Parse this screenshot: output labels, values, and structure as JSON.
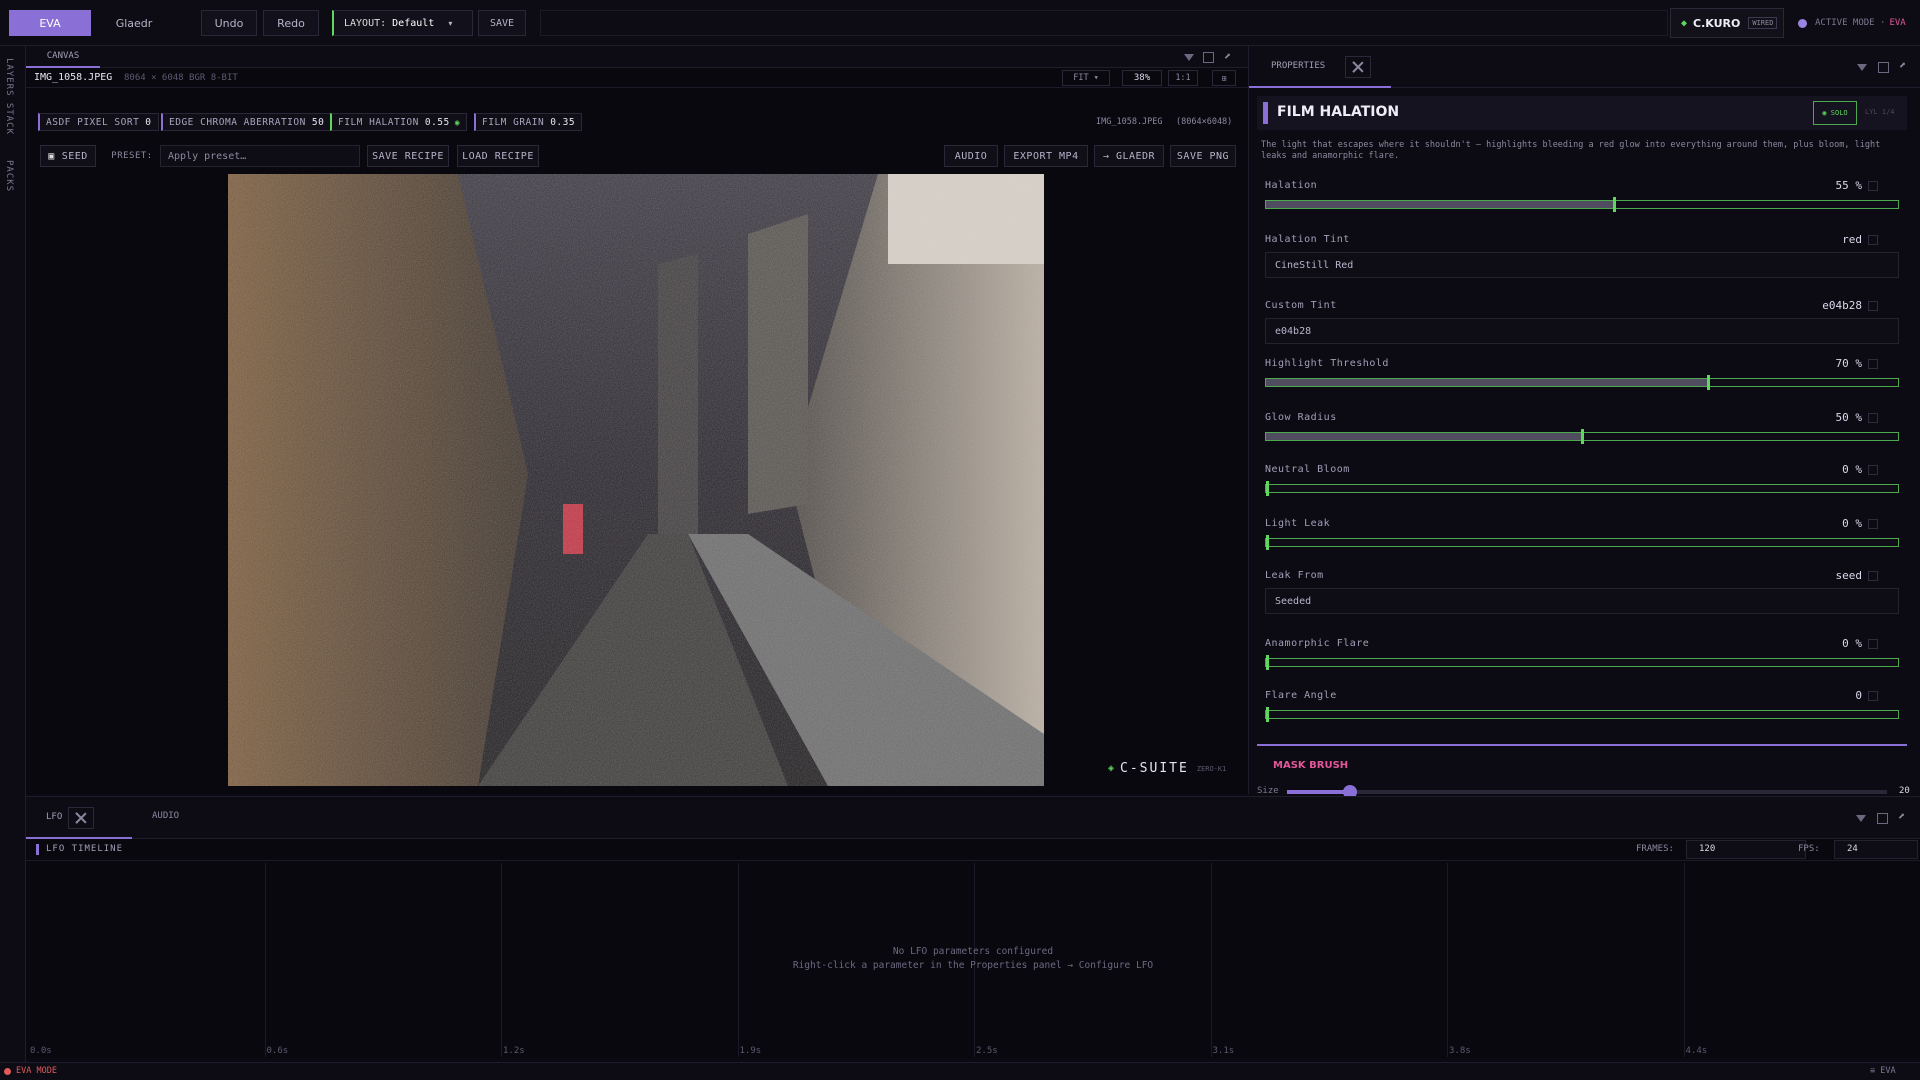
{
  "topbar": {
    "tab_eva": "EVA",
    "tab_glaedr": "Glaedr",
    "undo": "Undo",
    "redo": "Redo",
    "layout_label": "LAYOUT:",
    "layout_value": "Default",
    "save": "SAVE",
    "user": "C.KURO",
    "wired": "WIRED",
    "active_mode_label": "ACTIVE MODE ·",
    "active_mode_value": "EVA"
  },
  "leftrail": {
    "tab1": "LAYERS STACK",
    "tab2": "PACKS"
  },
  "canvas": {
    "tab": "CANVAS",
    "filename": "IMG_1058.JPEG",
    "fileinfo": "8064 × 6048 BGR 8-BIT",
    "fit": "FIT ▾",
    "zoom": "38%",
    "one_to_one": "1:1",
    "chips": [
      {
        "label": "ASDF PIXEL SORT",
        "value": "0"
      },
      {
        "label": "EDGE CHROMA ABERRATION",
        "value": "50"
      },
      {
        "label": "FILM HALATION",
        "value": "0.55"
      },
      {
        "label": "FILM GRAIN",
        "value": "0.35"
      }
    ],
    "info_right": "IMG_1058.JPEG",
    "info_dims": "(8064×6048)",
    "seed": "SEED",
    "preset_label": "PRESET:",
    "preset_placeholder": "Apply preset…",
    "save_recipe": "SAVE RECIPE",
    "load_recipe": "LOAD RECIPE",
    "audio": "AUDIO",
    "export_mp4": "EXPORT MP4",
    "to_glaedr": "→ GLAEDR",
    "save_png": "SAVE PNG",
    "brand": "C-SUITE",
    "brand_sub": "ZERO-K1"
  },
  "properties": {
    "tab": "PROPERTIES",
    "title": "FILM HALATION",
    "badge_solo": "◉ SOLO",
    "badge_extra": "LYL 1/4",
    "description": "The light that escapes where it shouldn't — highlights bleeding a red glow into everything around them, plus bloom, light leaks and anamorphic flare.",
    "params": [
      {
        "label": "Halation",
        "value": "55 %",
        "level": 0.55
      },
      {
        "label": "Halation Tint",
        "value": "red",
        "field": "CineStill Red"
      },
      {
        "label": "Custom Tint",
        "value": "e04b28",
        "field": "e04b28"
      },
      {
        "label": "Highlight Threshold",
        "value": "70 %",
        "level": 0.7
      },
      {
        "label": "Glow Radius",
        "value": "50 %",
        "level": 0.5
      },
      {
        "label": "Neutral Bloom",
        "value": "0 %",
        "level": 0
      },
      {
        "label": "Light Leak",
        "value": "0 %",
        "level": 0
      },
      {
        "label": "Leak From",
        "value": "seed",
        "field": "Seeded"
      },
      {
        "label": "Anamorphic Flare",
        "value": "0 %",
        "level": 0
      },
      {
        "label": "Flare Angle",
        "value": "0",
        "level": 0
      }
    ],
    "mask_brush": "MASK BRUSH",
    "size_label": "Size",
    "size_value": "20"
  },
  "lfo": {
    "tab_lfo": "LFO",
    "tab_audio": "AUDIO",
    "timeline_title": "LFO TIMELINE",
    "frames_label": "FRAMES:",
    "frames_value": "120",
    "fps_label": "FPS:",
    "fps_value": "24",
    "empty_line1": "No LFO parameters configured",
    "empty_line2": "Right-click a parameter in the Properties panel → Configure LFO",
    "ticks": [
      "0.0s",
      "0.6s",
      "1.2s",
      "1.9s",
      "2.5s",
      "3.1s",
      "3.8s",
      "4.4s"
    ]
  },
  "status": {
    "mode": "EVA MODE",
    "right": "≡ EVA"
  },
  "colors": {
    "accent": "#8a6fd6",
    "slider": "#5fd75f",
    "mask": "#e3579a",
    "status": "#e05a5a"
  }
}
